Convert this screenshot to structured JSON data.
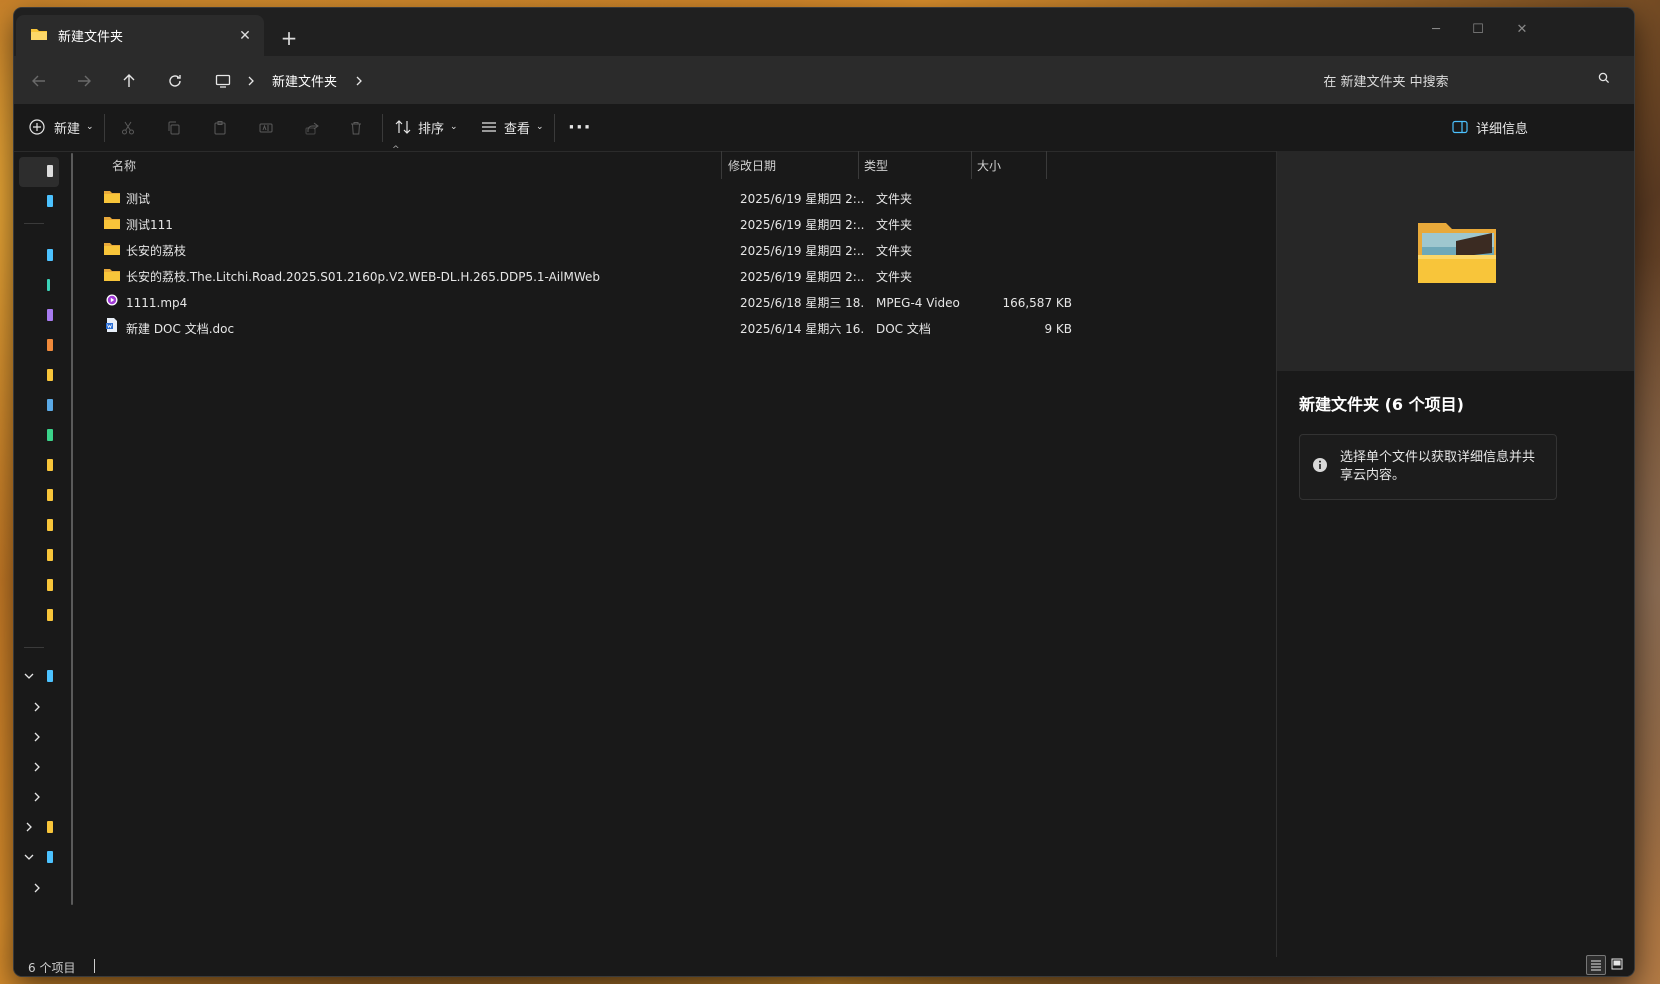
{
  "tab": {
    "title": "新建文件夹",
    "new_tab": "+"
  },
  "window_controls": {
    "minimize": "─",
    "maximize": "☐",
    "close": "✕"
  },
  "address": {
    "breadcrumb": [
      "新建文件夹"
    ],
    "search_placeholder": "在 新建文件夹 中搜索"
  },
  "toolbar": {
    "new_label": "新建",
    "sort_label": "排序",
    "view_label": "查看",
    "more_label": "···",
    "details_label": "详细信息"
  },
  "columns": {
    "name": "名称",
    "date": "修改日期",
    "type": "类型",
    "size": "大小"
  },
  "files": [
    {
      "name": "测试",
      "date": "2025/6/19 星期四  2:...",
      "type": "文件夹",
      "size": "",
      "icon": "folder-icon"
    },
    {
      "name": "测试111",
      "date": "2025/6/19 星期四  2:...",
      "type": "文件夹",
      "size": "",
      "icon": "folder-icon"
    },
    {
      "name": "长安的荔枝",
      "date": "2025/6/19 星期四  2:...",
      "type": "文件夹",
      "size": "",
      "icon": "folder-icon"
    },
    {
      "name": "长安的荔枝.The.Litchi.Road.2025.S01.2160p.V2.WEB-DL.H.265.DDP5.1-AilMWeb",
      "date": "2025/6/19 星期四  2:...",
      "type": "文件夹",
      "size": "",
      "icon": "folder-icon"
    },
    {
      "name": "1111.mp4",
      "date": "2025/6/18 星期三  18...",
      "type": "MPEG-4 Video",
      "size": "166,587 KB",
      "icon": "video-file-icon"
    },
    {
      "name": "新建 DOC 文档.doc",
      "date": "2025/6/14 星期六  16...",
      "type": "DOC 文档",
      "size": "9 KB",
      "icon": "doc-file-icon"
    }
  ],
  "details": {
    "title": "新建文件夹 (6 个项目)",
    "info": "选择单个文件以获取详细信息并共享云内容。"
  },
  "status": {
    "count": "6 个项目"
  },
  "colors": {
    "window_bg": "#191919",
    "bar_bg": "#2b2b2b",
    "folder": "#f8c53a",
    "accent_blue": "#4cc2ff"
  }
}
